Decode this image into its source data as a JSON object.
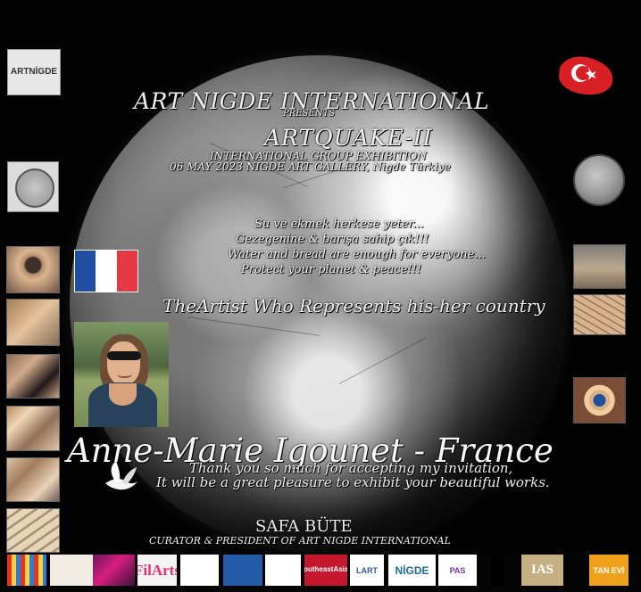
{
  "poster": {
    "organization": "ART NIGDE INTERNATIONAL",
    "presents": "PRESENTS",
    "event_title": "ARTQUAKE-II",
    "event_line_1": "INTERNATIONAL GROUP EXHIBITION",
    "event_line_2": "06 MAY 2023 NIGDE ART GALLERY, Nigde Türkiye",
    "poem_lines": [
      "Su ve ekmek herkese yeter...",
      "Gezegenine & barışa sahip çık!!!",
      "Water and bread are enough for everyone...",
      "Protect your planet & peace!!!"
    ],
    "represents_line": "TheArtist Who Represents his-her country",
    "artist_line": "Anne-Marie Igounet - France",
    "thanks_line_1": "Thank you so much for accepting my invitation,",
    "thanks_line_2": "It will be a great pleasure to exhibit your beautiful works.",
    "curator_name": "SAFA BÜTE",
    "curator_title": "CURATOR & PRESIDENT OF ART NIGDE INTERNATIONAL"
  },
  "top_left_logo": "ARTNİGDE",
  "bottom_logos": [
    "",
    "",
    "",
    "FilArts",
    "",
    "",
    "",
    "SoutheastAsian",
    "LART",
    "NİGDE",
    "PAS",
    "",
    "IAS",
    "TAN EVİ"
  ],
  "colors": {
    "background": "#020202",
    "text": "#efefef",
    "france_blue": "#1f4ea3",
    "france_white": "#ffffff",
    "france_red": "#e63945",
    "turkey_red": "#d81f26"
  },
  "icons": {
    "turkey_flag": "turkey-flag-icon",
    "coin_left": "ancient-coin-icon",
    "coin_right": "ancient-coin-icon",
    "dove": "dove-icon"
  }
}
